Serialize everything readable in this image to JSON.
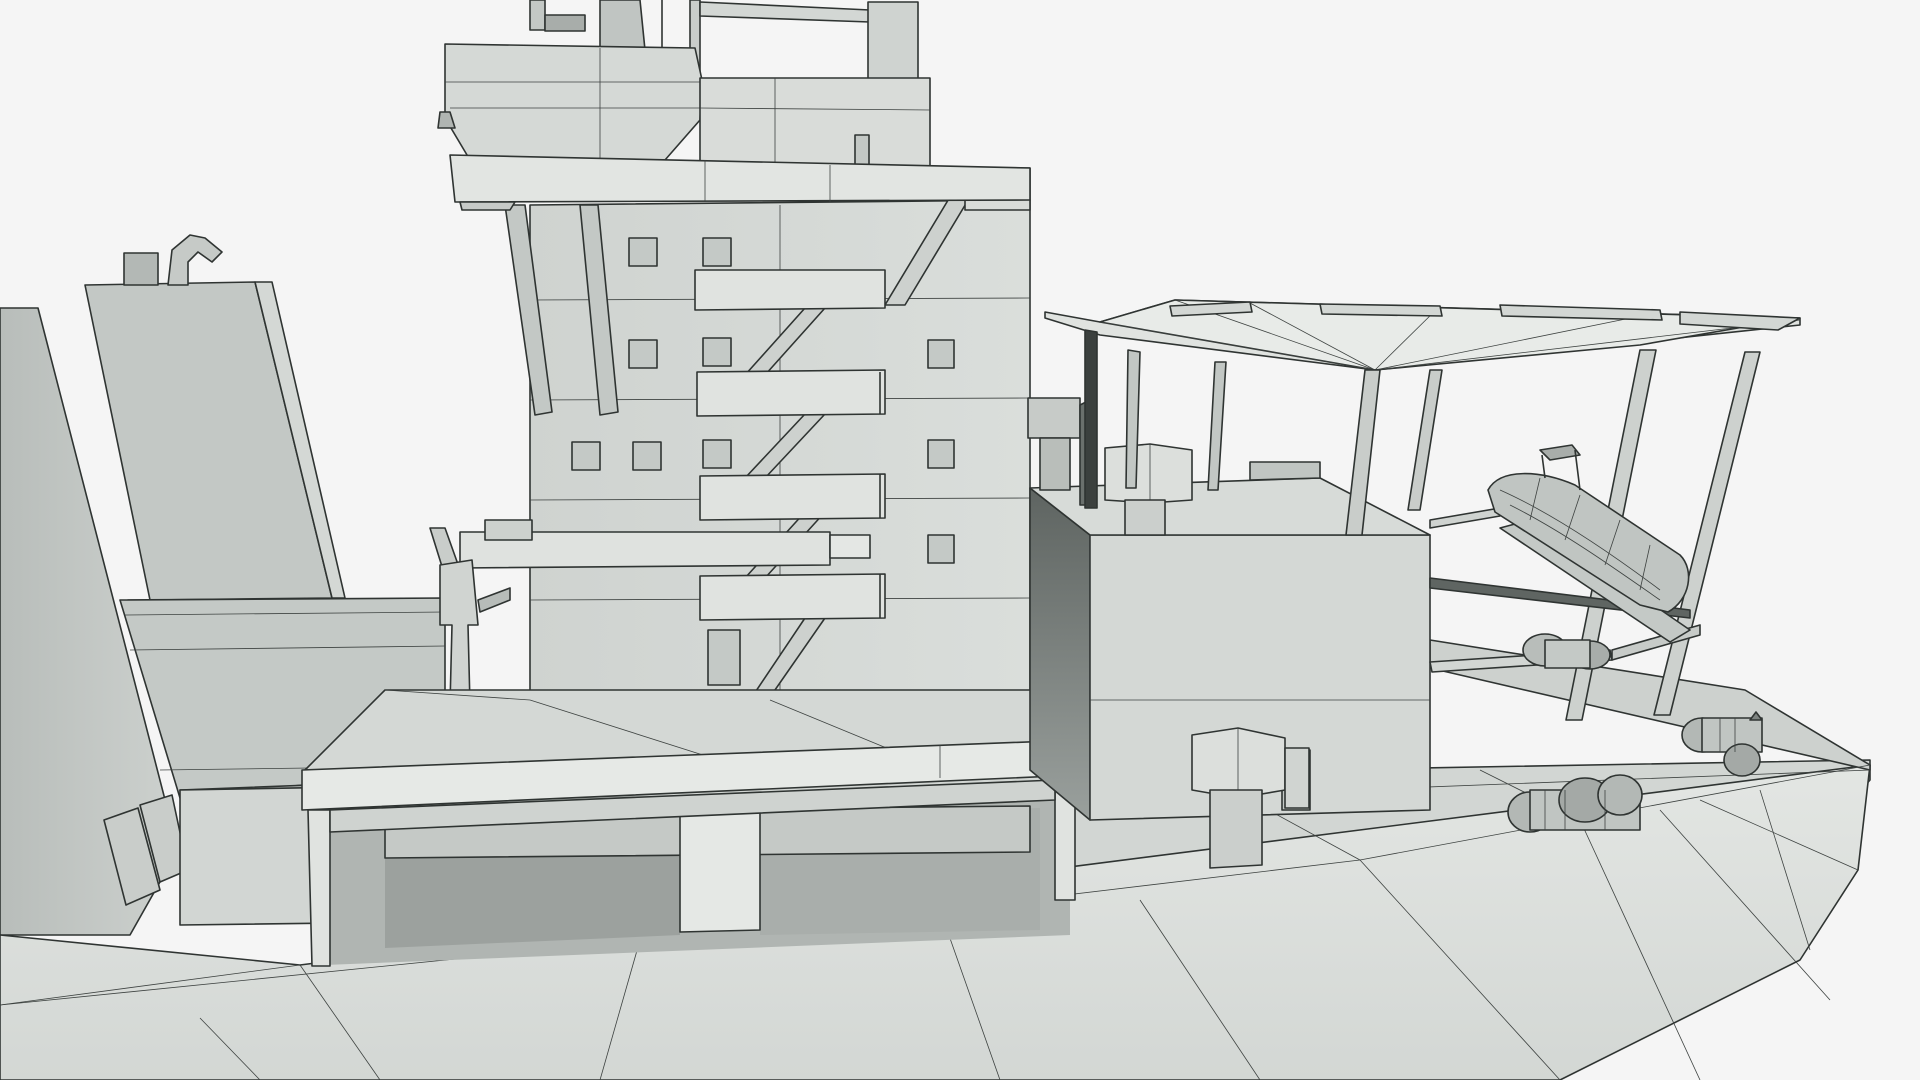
{
  "scene": {
    "subject": "ship-model-wireframe",
    "colors": {
      "background": "#f5f5f5",
      "surface": "#d6dad7",
      "surface_light": "#e2e5e2",
      "surface_dark": "#b9bebb",
      "shadow": "#7f8582",
      "edge": "#2f3432"
    }
  }
}
